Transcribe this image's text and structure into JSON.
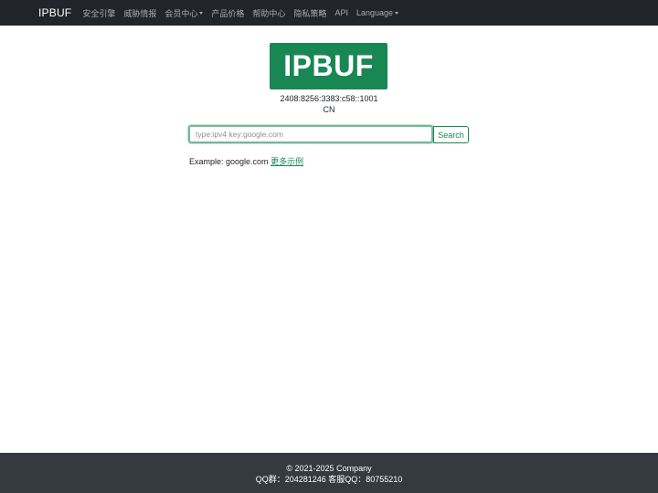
{
  "navbar": {
    "brand": "IPBUF",
    "items": [
      {
        "label": "安全引擎"
      },
      {
        "label": "威胁情报"
      },
      {
        "label": "会员中心"
      },
      {
        "label": "产品价格"
      },
      {
        "label": "帮助中心"
      },
      {
        "label": "隐私策略"
      },
      {
        "label": "API"
      },
      {
        "label": "Language"
      }
    ]
  },
  "main": {
    "logo_text": "IPBUF",
    "ip_address": "2408:8256:3383:c58::1001",
    "country": "CN",
    "search": {
      "placeholder": "type:ipv4 key:google.com",
      "value": "",
      "button_label": "Search"
    },
    "example_prefix": "Example: google.com",
    "example_link": "更多示例"
  },
  "footer": {
    "copyright": "© 2021-2025 Company",
    "contact": "QQ群：204281246 客服QQ：80755210"
  },
  "colors": {
    "navbar_bg": "#212529",
    "accent": "#198754",
    "footer_bg": "#343a40"
  }
}
